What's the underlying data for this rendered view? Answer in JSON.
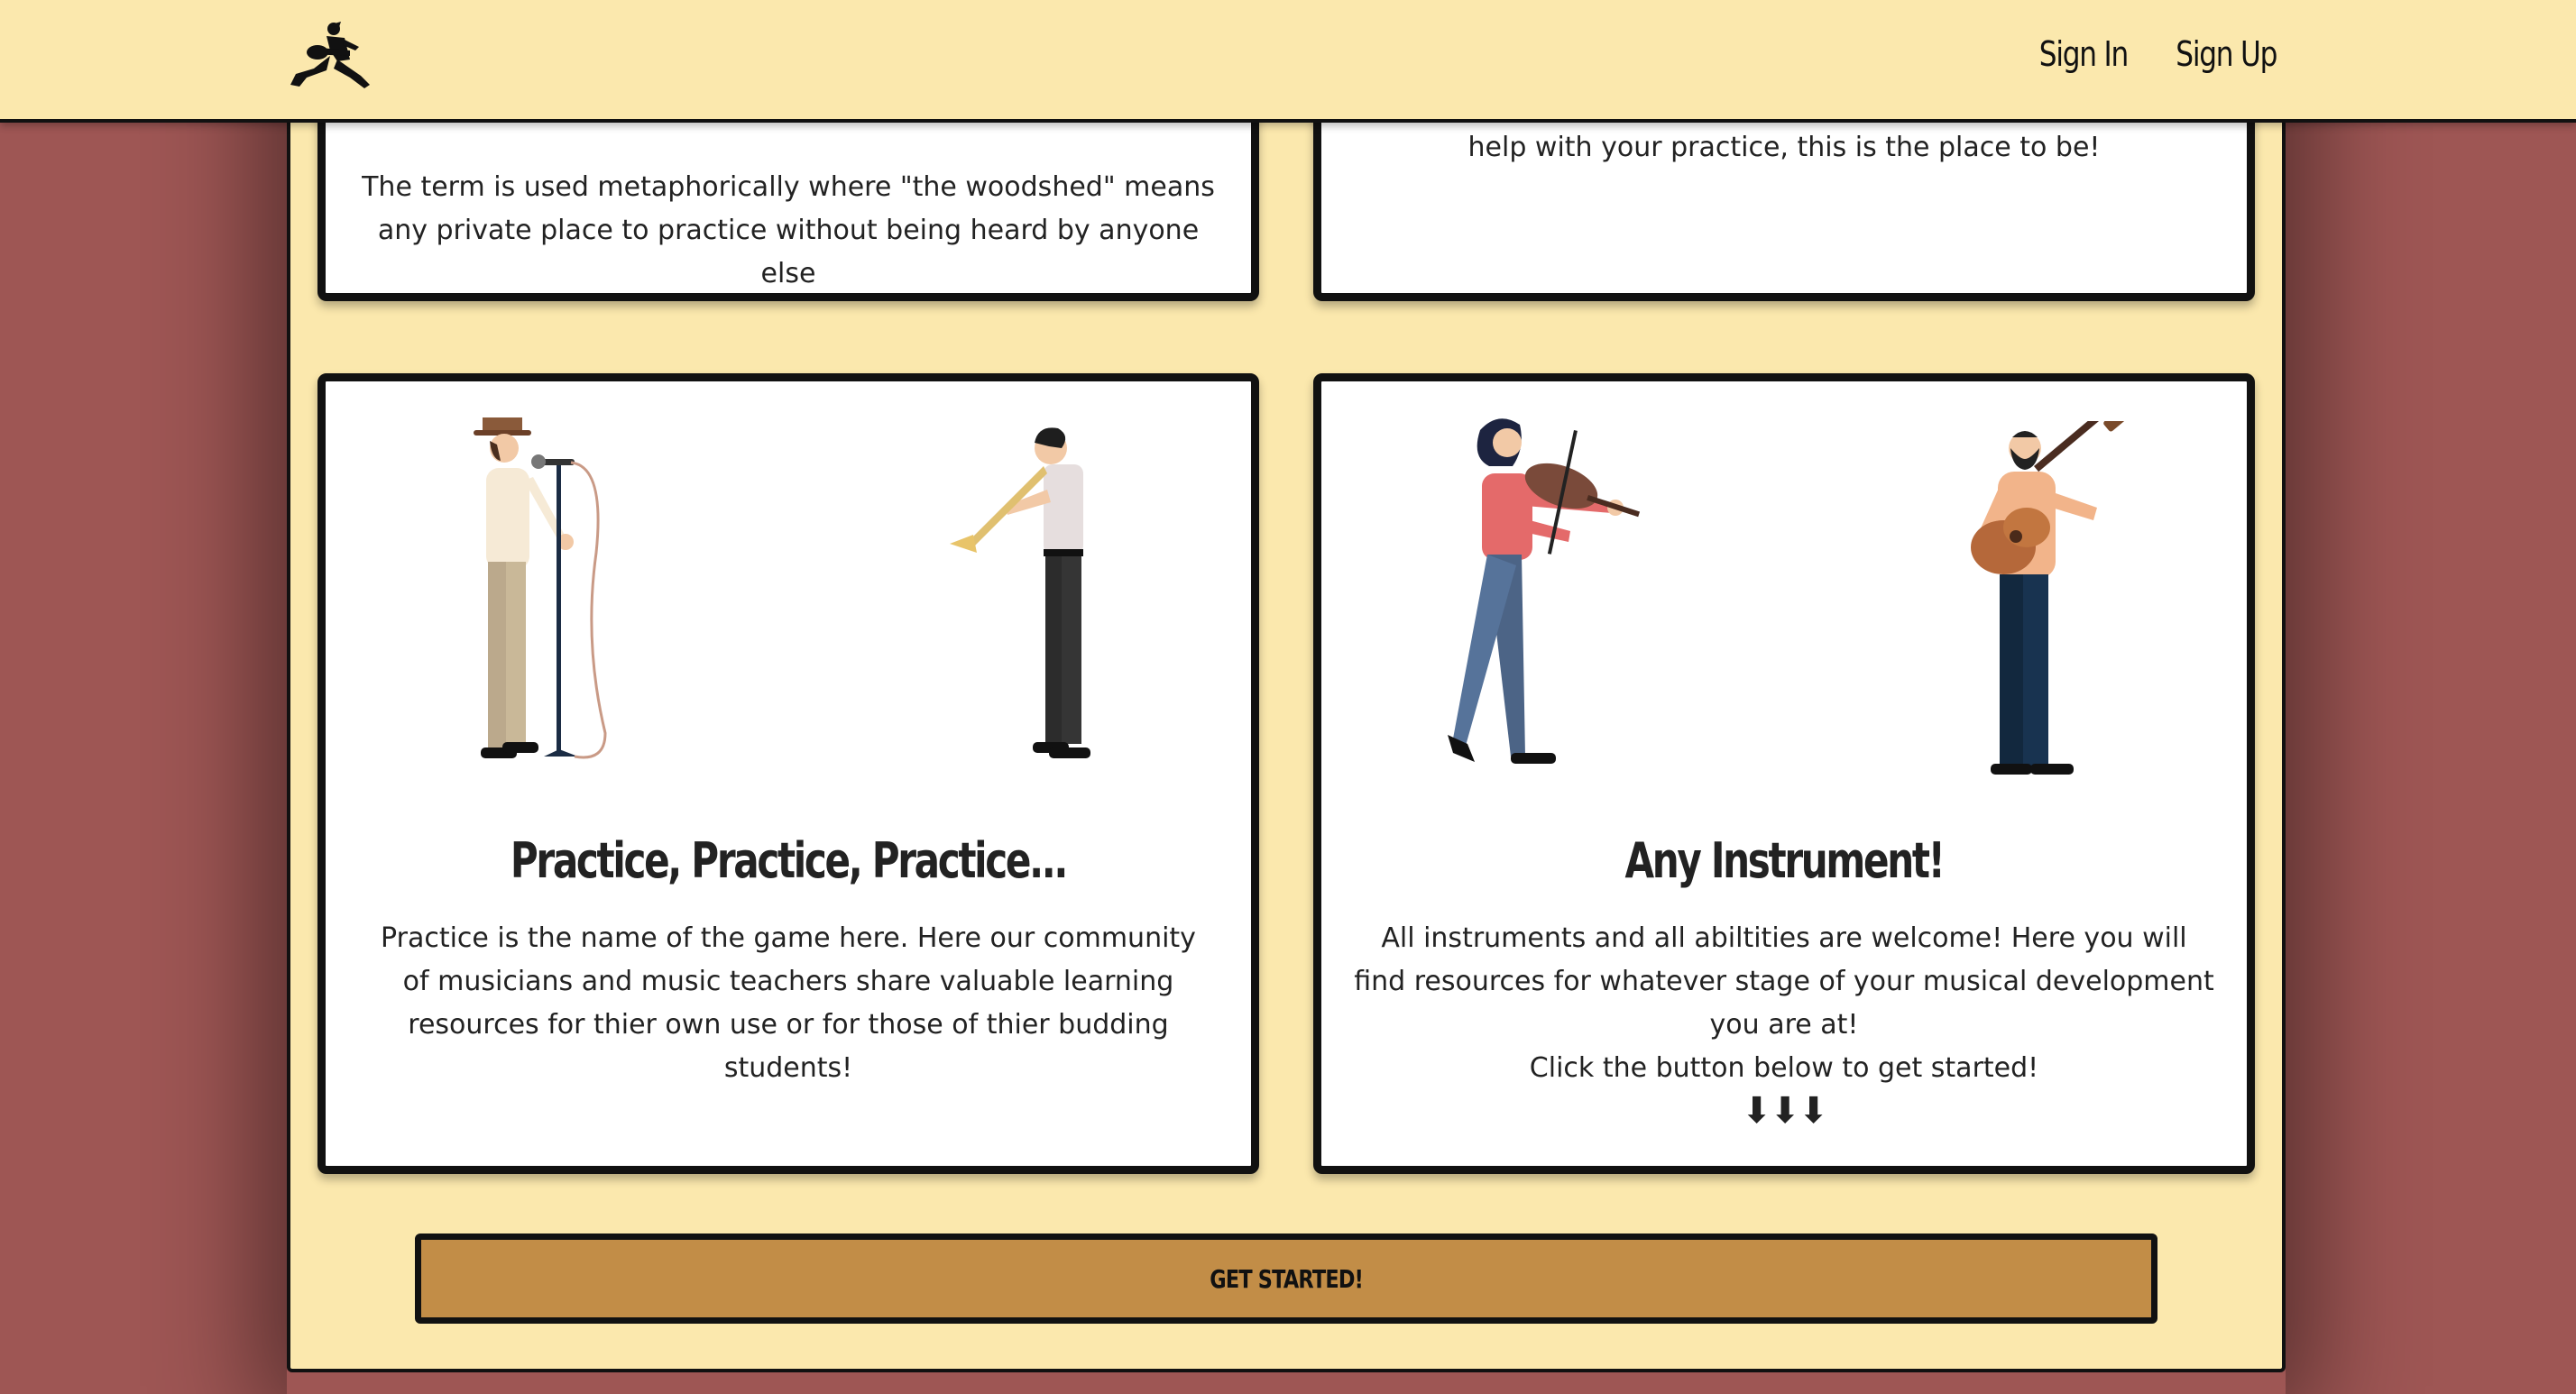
{
  "navbar": {
    "logo_icon": "jumping-guitarist-icon",
    "sign_in": "Sign In",
    "sign_up": "Sign Up"
  },
  "cards": {
    "woodshed": {
      "text": "The term is used metaphorically where \"the woodshed\" means any private place to practice without being heard by anyone else"
    },
    "help": {
      "text": "help with your practice, this is the place to be!"
    },
    "practice": {
      "title": "Practice, Practice, Practice...",
      "text": "Practice is the name of the game here. Here our community of musicians and music teachers share valuable learning resources for thier own use or for those of thier budding students!"
    },
    "instrument": {
      "title": "Any Instrument!",
      "text": "All instruments and all abiltities are welcome! Here you will find resources for whatever stage of your musical development you are at!",
      "cta_hint": "Click the button below to get started!",
      "arrows": "⬇⬇⬇"
    }
  },
  "cta": {
    "label": "GET STARTED!"
  },
  "colors": {
    "background": "#9e5654",
    "panel": "#fbe8ad",
    "button": "#c28d47",
    "border": "#111111"
  }
}
